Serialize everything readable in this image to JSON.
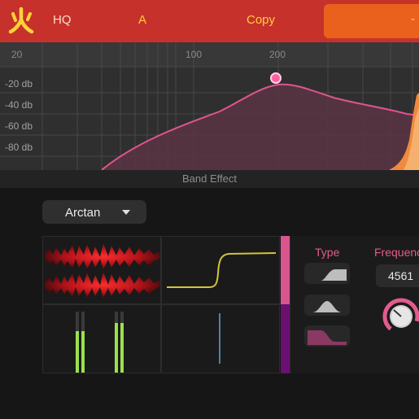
{
  "header": {
    "quality_label": "HQ",
    "ab_label": "A",
    "copy_label": "Copy",
    "preset_label": "-",
    "accent_color": "#c7312c"
  },
  "eq": {
    "freq_labels": [
      "20",
      "100",
      "200"
    ],
    "db_labels": [
      "-20 db",
      "-40 db",
      "-60 db",
      "-80 db"
    ],
    "curve_color": "#e0558f"
  },
  "band": {
    "title": "Band Effect",
    "algorithm": "Arctan",
    "type_title": "Type",
    "types": [
      "shelf-high-icon",
      "bell-icon",
      "shelf-low-icon"
    ],
    "selected_type": "shelf-low-icon",
    "frequency_title": "Frequence",
    "frequency_value": "4561"
  }
}
